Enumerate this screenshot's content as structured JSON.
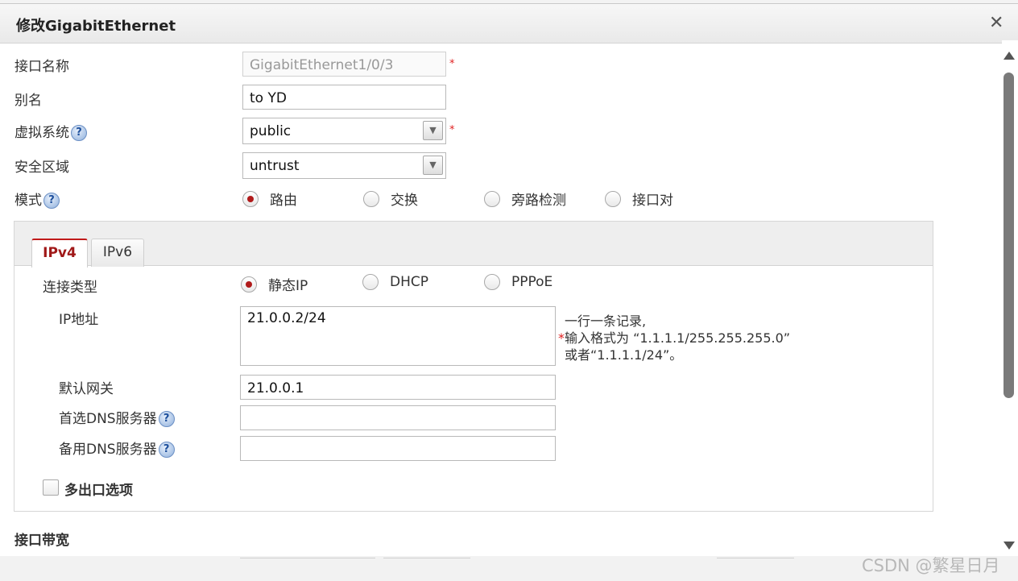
{
  "dialog": {
    "title": "修改GigabitEthernet",
    "close_glyph": "✕"
  },
  "form": {
    "interface_name": {
      "label": "接口名称",
      "value": "GigabitEthernet1/0/3",
      "required_mark": "*"
    },
    "alias": {
      "label": "别名",
      "value": "to YD"
    },
    "virtual_system": {
      "label": "虚拟系统",
      "value": "public",
      "required_mark": "*"
    },
    "security_zone": {
      "label": "安全区域",
      "value": "untrust"
    },
    "mode": {
      "label": "模式",
      "options": [
        "路由",
        "交换",
        "旁路检测",
        "接口对"
      ],
      "selected": "路由"
    }
  },
  "ip_panel": {
    "tabs": [
      "IPv4",
      "IPv6"
    ],
    "active_tab": "IPv4",
    "connection_type": {
      "label": "连接类型",
      "options": [
        "静态IP",
        "DHCP",
        "PPPoE"
      ],
      "selected": "静态IP"
    },
    "ip_address": {
      "label": "IP地址",
      "value": "21.0.0.2/24",
      "hint_line1": "一行一条记录,",
      "hint_star": "*",
      "hint_line2": "输入格式为 “1.1.1.1/255.255.255.0”",
      "hint_line3": "或者“1.1.1.1/24”。"
    },
    "default_gateway": {
      "label": "默认网关",
      "value": "21.0.0.1"
    },
    "primary_dns": {
      "label": "首选DNS服务器",
      "value": ""
    },
    "secondary_dns": {
      "label": "备用DNS服务器",
      "value": ""
    },
    "multi_egress": {
      "label": "多出口选项",
      "checked": false
    }
  },
  "bandwidth": {
    "label": "接口带宽"
  },
  "help_glyph": "?",
  "watermark": "CSDN @繁星日月",
  "colors": {
    "accent_red": "#c01a1a",
    "required_star": "#e02020",
    "help_blue": "#1d4f9c"
  }
}
